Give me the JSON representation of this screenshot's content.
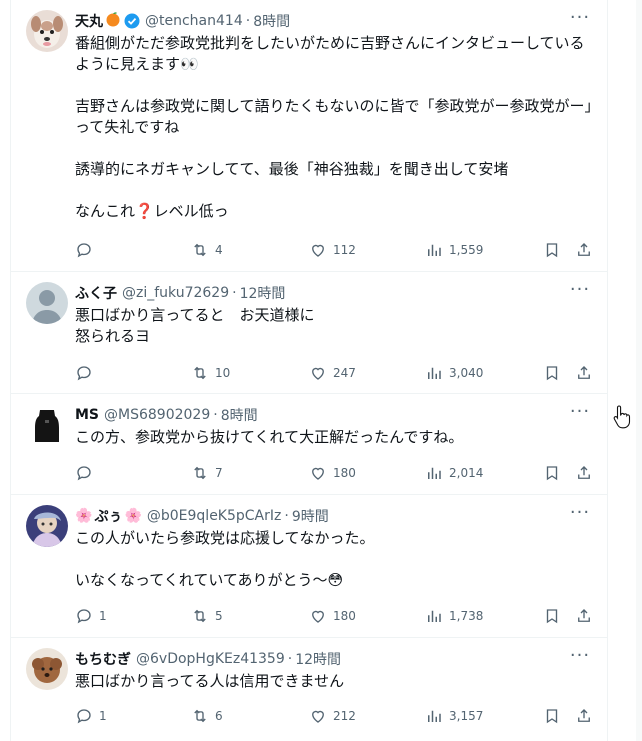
{
  "tweets": [
    {
      "name": "天丸",
      "handle": "@tenchan414",
      "time": "8時間",
      "lines": [
        "番組側がただ参政党批判をしたいがために吉野さんにインタビューしている",
        "ように見えます👀",
        "",
        "吉野さんは参政党に関して語りたくもないのに皆で「参政党がー参政党がー」",
        "って失礼ですね",
        "",
        "誘導的にネガキャンしてて、最後「神谷独裁」を聞き出して安堵",
        "",
        "なんこれ❓レベル低っ"
      ],
      "replies": "",
      "retweets": "4",
      "likes": "112",
      "views": "1,559"
    },
    {
      "name": "ふく子",
      "handle": "@zi_fuku72629",
      "time": "12時間",
      "lines": [
        "悪口ばかり言ってると　お天道様に",
        "怒られるヨ"
      ],
      "replies": "",
      "retweets": "10",
      "likes": "247",
      "views": "3,040"
    },
    {
      "name": "MS",
      "handle": "@MS68902029",
      "time": "8時間",
      "lines": [
        "この方、参政党から抜けてくれて大正解だったんですね。"
      ],
      "replies": "",
      "retweets": "7",
      "likes": "180",
      "views": "2,014"
    },
    {
      "name": "ぷぅ",
      "name_prefix": "🌸",
      "name_suffix": "🌸",
      "handle": "@b0E9qleK5pCArIz",
      "time": "9時間",
      "lines": [
        "この人がいたら参政党は応援してなかった。",
        "",
        "いなくなってくれていてありがとう～😳"
      ],
      "replies": "1",
      "retweets": "5",
      "likes": "180",
      "views": "1,738"
    },
    {
      "name": "もちむぎ",
      "handle": "@6vDopHgKEz41359",
      "time": "12時間",
      "lines": [
        "悪口ばかり言ってる人は信用できません"
      ],
      "replies": "1",
      "retweets": "6",
      "likes": "212",
      "views": "3,157"
    }
  ],
  "separator": "·",
  "more_label": "···",
  "colors": {
    "text": "#0f1419",
    "muted": "#536471",
    "border": "#eff3f4",
    "verified": "#1d9bf0"
  },
  "icons": [
    "reply-icon",
    "retweet-icon",
    "like-icon",
    "views-icon",
    "bookmark-icon",
    "share-icon",
    "verified-badge-icon",
    "more-icon"
  ]
}
